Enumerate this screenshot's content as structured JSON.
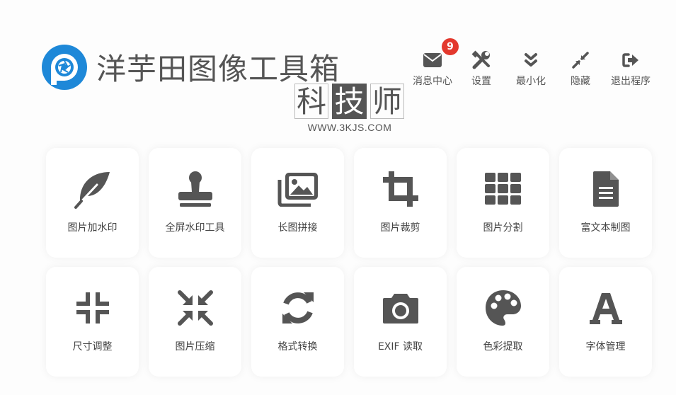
{
  "app": {
    "title": "洋芋田图像工具箱"
  },
  "toolbar": {
    "messages": {
      "label": "消息中心",
      "badge": "9",
      "icon": "envelope-icon"
    },
    "settings": {
      "label": "设置",
      "icon": "tools-icon"
    },
    "minimize": {
      "label": "最小化",
      "icon": "double-chevron-down-icon"
    },
    "hide": {
      "label": "隐藏",
      "icon": "compress-arrows-icon"
    },
    "exit": {
      "label": "退出程序",
      "icon": "sign-out-icon"
    }
  },
  "watermark": {
    "chars": [
      "科",
      "技",
      "师"
    ],
    "url": "WWW.3KJS.COM"
  },
  "tools": [
    {
      "label": "图片加水印",
      "icon": "feather-icon"
    },
    {
      "label": "全屏水印工具",
      "icon": "stamp-icon"
    },
    {
      "label": "长图拼接",
      "icon": "images-icon"
    },
    {
      "label": "图片裁剪",
      "icon": "crop-icon"
    },
    {
      "label": "图片分割",
      "icon": "grid-icon"
    },
    {
      "label": "富文本制图",
      "icon": "document-icon"
    },
    {
      "label": "尺寸调整",
      "icon": "compress-icon"
    },
    {
      "label": "图片压缩",
      "icon": "compress-arrows-icon"
    },
    {
      "label": "格式转换",
      "icon": "sync-icon"
    },
    {
      "label": "EXIF 读取",
      "icon": "camera-icon"
    },
    {
      "label": "色彩提取",
      "icon": "palette-icon"
    },
    {
      "label": "字体管理",
      "icon": "font-icon"
    }
  ],
  "colors": {
    "icon": "#555555",
    "badge": "#e3382d",
    "logo_blue": "#1e88d8"
  }
}
